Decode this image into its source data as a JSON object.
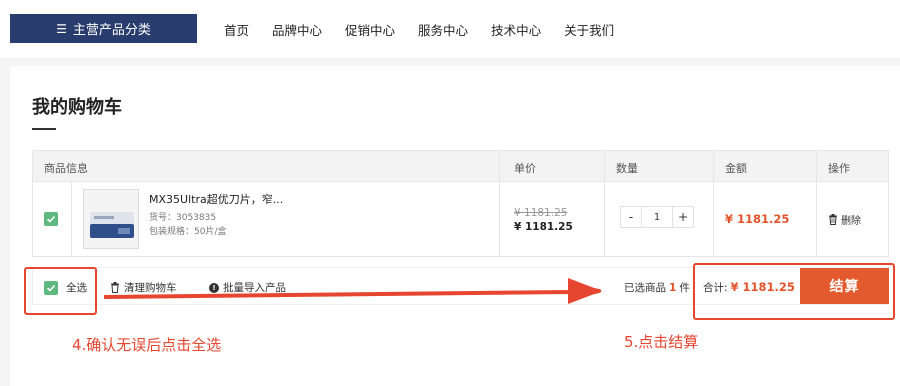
{
  "nav": {
    "category_button": "主营产品分类",
    "links": [
      "首页",
      "品牌中心",
      "促销中心",
      "服务中心",
      "技术中心",
      "关于我们"
    ]
  },
  "cart": {
    "title": "我的购物车",
    "headers": {
      "product_info": "商品信息",
      "unit_price": "单价",
      "quantity": "数量",
      "amount": "金额",
      "actions": "操作"
    },
    "item": {
      "name": "MX35Ultra超优刀片，窄...",
      "sku": "货号：3053835",
      "packaging": "包装规格：50片/盒",
      "original_price": "¥ 1181.25",
      "price": "¥ 1181.25",
      "quantity": "1",
      "amount": "¥ 1181.25",
      "delete_label": "删除"
    },
    "footer": {
      "select_all": "全选",
      "clear_cart": "清理购物车",
      "bulk_import": "批量导入产品",
      "selected_prefix": "已选商品",
      "selected_count": "1",
      "selected_suffix": "件",
      "total_label": "合计:",
      "total_value": "¥ 1181.25",
      "checkout": "结算"
    }
  },
  "annotations": {
    "step4": "4.确认无误后点击全选",
    "step5": "5.点击结算"
  },
  "colors": {
    "nav_dark": "#283d6e",
    "accent": "#e25a2e",
    "price_red": "#e2532b",
    "annotation_red": "#e6452f",
    "check_green": "#5fb87e"
  }
}
